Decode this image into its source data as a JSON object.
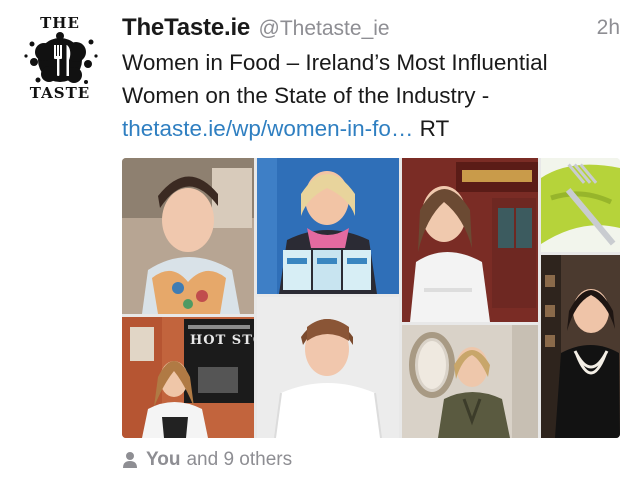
{
  "tweet": {
    "avatar": {
      "brand_top": "THE",
      "brand_bottom": "TASTE"
    },
    "display_name": "TheTaste.ie",
    "handle": "@Thetaste_ie",
    "timestamp": "2h",
    "text_line1": "Women in Food – Ireland’s Most Influential",
    "text_line2": "Women on the State of the Industry -",
    "link_text": "thetaste.ie/wp/women-in-fo…",
    "suffix": " RT",
    "media": {
      "sign_text": "HOT STO"
    },
    "footer": {
      "you": "You",
      "others": "and 9 others"
    }
  },
  "colors": {
    "link": "#2f7fc1",
    "muted": "#8e8e93",
    "text": "#1a1a1a"
  },
  "icons": [
    "person-icon",
    "fork-knife-icon"
  ]
}
